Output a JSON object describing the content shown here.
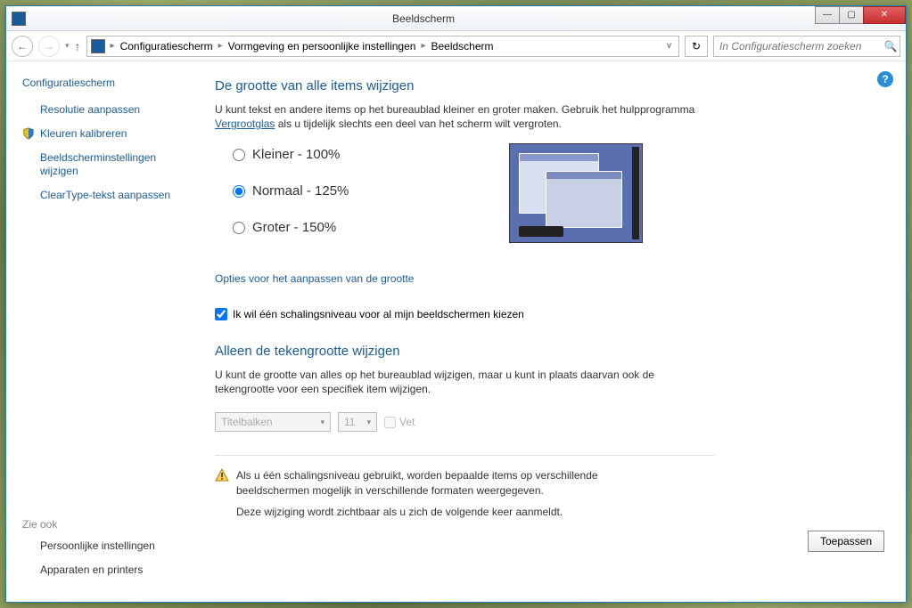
{
  "window": {
    "title": "Beeldscherm"
  },
  "nav": {
    "breadcrumbs": [
      "Configuratiescherm",
      "Vormgeving en persoonlijke instellingen",
      "Beeldscherm"
    ],
    "search_placeholder": "In Configuratiescherm zoeken"
  },
  "sidebar": {
    "home": "Configuratiescherm",
    "links": [
      "Resolutie aanpassen",
      "Kleuren kalibreren",
      "Beeldscherminstellingen wijzigen",
      "ClearType-tekst aanpassen"
    ],
    "see_also_header": "Zie ook",
    "see_also": [
      "Persoonlijke instellingen",
      "Apparaten en printers"
    ]
  },
  "main": {
    "heading1": "De grootte van alle items wijzigen",
    "desc_part1": "U kunt tekst en andere items op het bureaublad kleiner en groter maken. Gebruik het hulpprogramma ",
    "magnifier_link": "Vergrootglas",
    "desc_part2": " als u tijdelijk slechts een deel van het scherm wilt vergroten.",
    "radios": {
      "smaller": "Kleiner - 100%",
      "normal": "Normaal - 125%",
      "larger": "Groter - 150%"
    },
    "custom_link": "Opties voor het aanpassen van de grootte",
    "checkbox_label": "Ik wil één schalingsniveau voor al mijn beeldschermen kiezen",
    "heading2": "Alleen de tekengrootte wijzigen",
    "desc2": "U kunt de grootte van alles op het bureaublad wijzigen, maar u kunt in plaats daarvan ook de tekengrootte voor een specifiek item wijzigen.",
    "item_select": "Titelbalken",
    "size_select": "11",
    "bold_label": "Vet",
    "warning": "Als u één schalingsniveau gebruikt, worden bepaalde items op verschillende beeldschermen mogelijk in verschillende formaten weergegeven.",
    "warning_sub": "Deze wijziging wordt zichtbaar als u zich de volgende keer aanmeldt.",
    "apply": "Toepassen"
  }
}
